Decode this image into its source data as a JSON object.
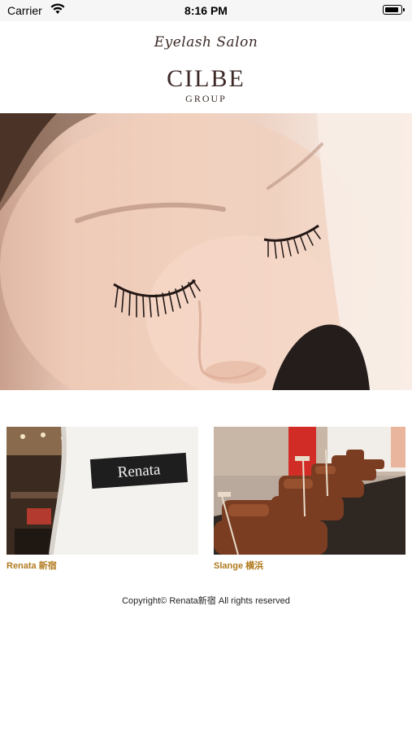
{
  "status_bar": {
    "carrier": "Carrier",
    "time": "8:16 PM"
  },
  "header": {
    "tagline": "Eyelash Salon",
    "brand": "CILBE",
    "group": "GROUP"
  },
  "carousel": {
    "page_count": 4,
    "active_index": 0
  },
  "salons": [
    {
      "label": "Renata 新宿",
      "sign_text": "Renata"
    },
    {
      "label": "Slange 横浜"
    }
  ],
  "footer": {
    "copyright": "Copyright© Renata新宿 All rights reserved"
  },
  "colors": {
    "accent": "#b07a1e",
    "brand": "#3d2a27"
  }
}
